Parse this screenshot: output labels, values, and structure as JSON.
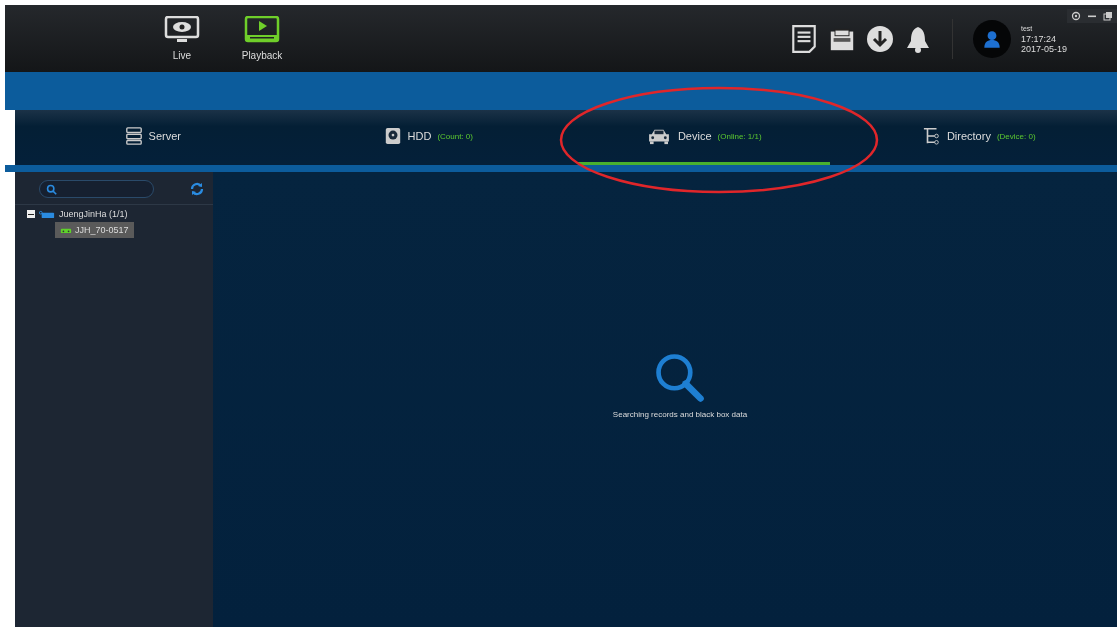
{
  "nav": [
    {
      "label": "Live",
      "kind": "live",
      "selected": false
    },
    {
      "label": "Playback",
      "kind": "playback",
      "selected": true
    }
  ],
  "user": {
    "name": "test",
    "time": "17:17:24",
    "date": "2017-05-19"
  },
  "tabs": [
    {
      "label": "Server",
      "kind": "server",
      "selected": false
    },
    {
      "label": "HDD",
      "count": "(Count: 0)",
      "kind": "hdd",
      "selected": false
    },
    {
      "label": "Device",
      "count": "(Online: 1/1)",
      "kind": "device",
      "selected": true
    },
    {
      "label": "Directory",
      "count": "(Device: 0)",
      "kind": "directory",
      "selected": false
    }
  ],
  "tree": [
    {
      "label": "JuengJinHa (1/1)",
      "expanded": true,
      "selected": false,
      "children": [
        {
          "label": "JJH_70-0517",
          "selected": true
        }
      ]
    }
  ],
  "message": "Searching records and black box data"
}
